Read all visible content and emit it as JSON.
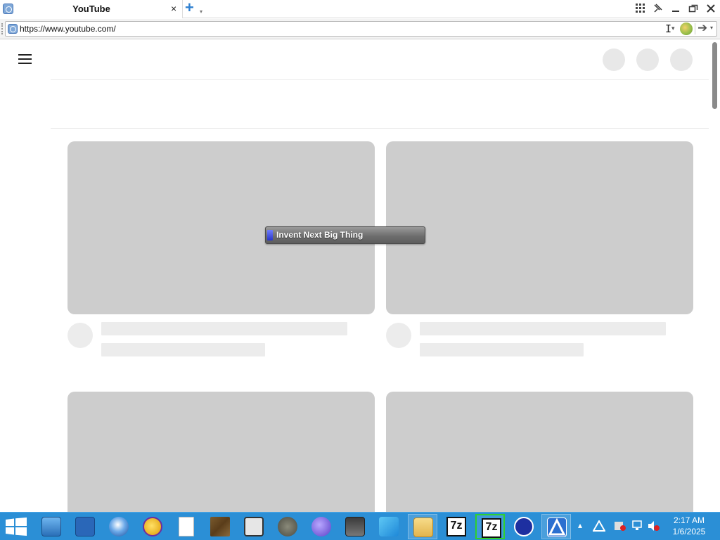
{
  "browser": {
    "tab": {
      "title": "YouTube",
      "close": "×"
    },
    "address": {
      "url": "https://www.youtube.com/"
    }
  },
  "tooltip": {
    "text": "Invent Next Big Thing"
  },
  "taskbar": {
    "apps": [
      "file-explorer-icon",
      "powershell-icon",
      "browser-icon",
      "yahoo-messenger-icon",
      "blank-document-icon",
      "minecraft-icon",
      "photo-app-icon",
      "gimp-icon",
      "virus-app-icon",
      "monitor-app-icon",
      "w-app-icon",
      "folder-icon",
      "7zip-icon",
      "7zip-icon",
      "f-app-icon",
      "a-app-icon"
    ],
    "active_app_color": "#2fd02f",
    "clock": {
      "time": "2:17 AM",
      "date": "1/6/2025"
    }
  },
  "colors": {
    "taskbar": "#2b8fd6",
    "placeholder": "#cdcdcd",
    "tooltip_accent": "#2835c8"
  }
}
